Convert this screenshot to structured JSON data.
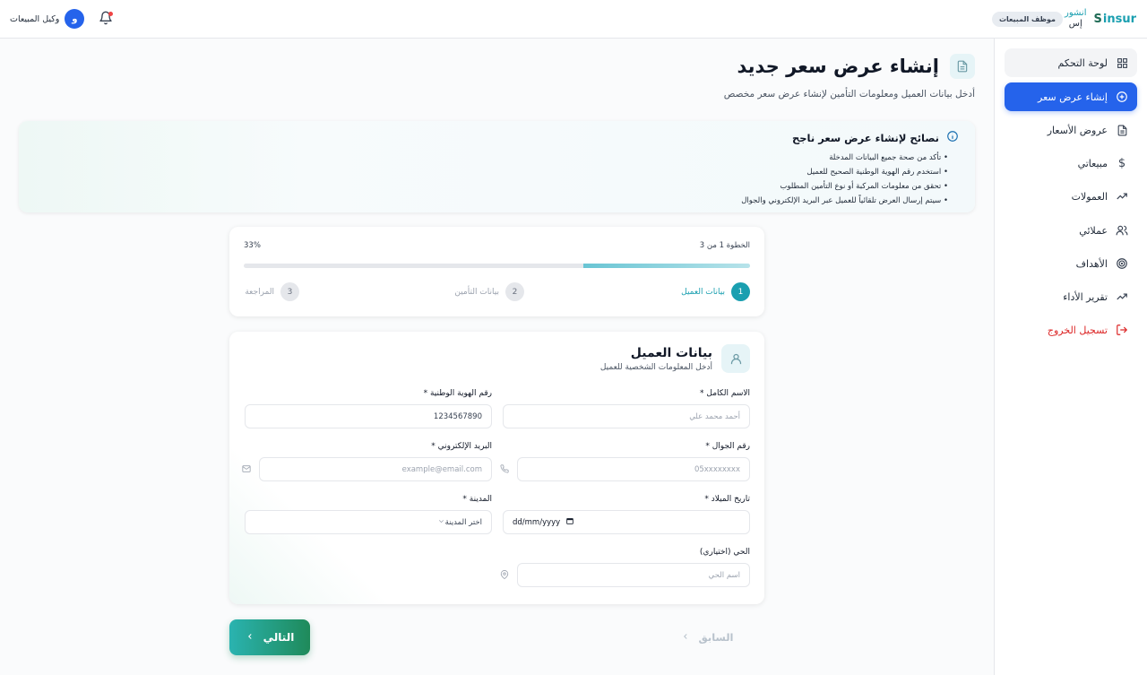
{
  "header": {
    "brand_logo_text": "insur",
    "brand_logo_prefix": "S",
    "brand_ar_line1": "انشور",
    "brand_ar_line2": "إس",
    "role_badge": "موظف المبيعات",
    "user_name": "وكيل المبيعات",
    "avatar_initial": "و"
  },
  "sidebar": {
    "items": [
      {
        "label": "لوحة التحكم",
        "icon": "grid-icon"
      },
      {
        "label": "إنشاء عرض سعر",
        "icon": "plus-circle-icon"
      },
      {
        "label": "عروض الأسعار",
        "icon": "document-icon"
      },
      {
        "label": "مبيعاتي",
        "icon": "dollar-icon"
      },
      {
        "label": "العمولات",
        "icon": "trend-icon"
      },
      {
        "label": "عملائي",
        "icon": "users-icon"
      },
      {
        "label": "الأهداف",
        "icon": "target-icon"
      },
      {
        "label": "تقرير الأداء",
        "icon": "trend-icon"
      },
      {
        "label": "تسجيل الخروج",
        "icon": "logout-icon"
      }
    ]
  },
  "page": {
    "title": "إنشاء عرض سعر جديد",
    "subtitle": "أدخل بيانات العميل ومعلومات التأمين لإنشاء عرض سعر مخصص"
  },
  "tips": {
    "title": "نصائح لإنشاء عرض سعر ناجح",
    "items": [
      "• تأكد من صحة جميع البيانات المدخلة",
      "• استخدم رقم الهوية الوطنية الصحيح للعميل",
      "• تحقق من معلومات المركبة أو نوع التأمين المطلوب",
      "• سيتم إرسال العرض تلقائياً للعميل عبر البريد الإلكتروني والجوال"
    ]
  },
  "stepper": {
    "step_text": "الخطوة 1 من 3",
    "percent_text": "33%",
    "progress": 0.33,
    "steps": [
      {
        "num": "1",
        "label": "بيانات العميل"
      },
      {
        "num": "2",
        "label": "بيانات التأمين"
      },
      {
        "num": "3",
        "label": "المراجعة"
      }
    ]
  },
  "form": {
    "title": "بيانات العميل",
    "subtitle": "أدخل المعلومات الشخصية للعميل",
    "full_name_label": "الاسم الكامل *",
    "full_name_placeholder": "أحمد محمد علي",
    "national_id_label": "رقم الهوية الوطنية *",
    "national_id_value": "1234567890",
    "mobile_label": "رقم الجوال *",
    "mobile_placeholder": "05xxxxxxxx",
    "email_label": "البريد الإلكتروني *",
    "email_placeholder": "example@email.com",
    "dob_label": "تاريخ الميلاد *",
    "dob_placeholder": "dd/mm/yyyy",
    "city_label": "المدينة *",
    "city_placeholder": "اختر المدينة",
    "district_label": "الحي (اختياري)",
    "district_placeholder": "اسم الحي"
  },
  "buttons": {
    "next": "التالي",
    "prev": "السابق"
  }
}
